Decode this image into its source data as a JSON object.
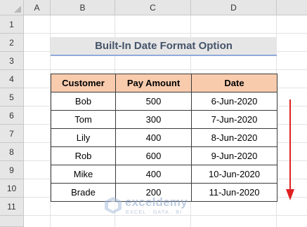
{
  "columns": [
    "A",
    "B",
    "C",
    "D"
  ],
  "rows": [
    "1",
    "2",
    "3",
    "4",
    "5",
    "6",
    "7",
    "8",
    "9",
    "10",
    "11"
  ],
  "title": "Built-In Date Format Option",
  "table": {
    "headers": [
      "Customer",
      "Pay Amount",
      "Date"
    ],
    "rows": [
      [
        "Bob",
        "500",
        "6-Jun-2020"
      ],
      [
        "Tom",
        "300",
        "7-Jun-2020"
      ],
      [
        "Lily",
        "400",
        "8-Jun-2020"
      ],
      [
        "Rob",
        "600",
        "9-Jun-2020"
      ],
      [
        "Mike",
        "400",
        "10-Jun-2020"
      ],
      [
        "Brade",
        "200",
        "11-Jun-2020"
      ]
    ]
  },
  "watermark": {
    "name": "exceldemy",
    "tagline": "EXCEL · DATA · BI"
  },
  "colors": {
    "header_fill": "#f8cbad",
    "title_fill": "#e7e6e6",
    "title_text": "#44546a",
    "title_underline": "#8ea9db",
    "arrow": "#e02020"
  }
}
